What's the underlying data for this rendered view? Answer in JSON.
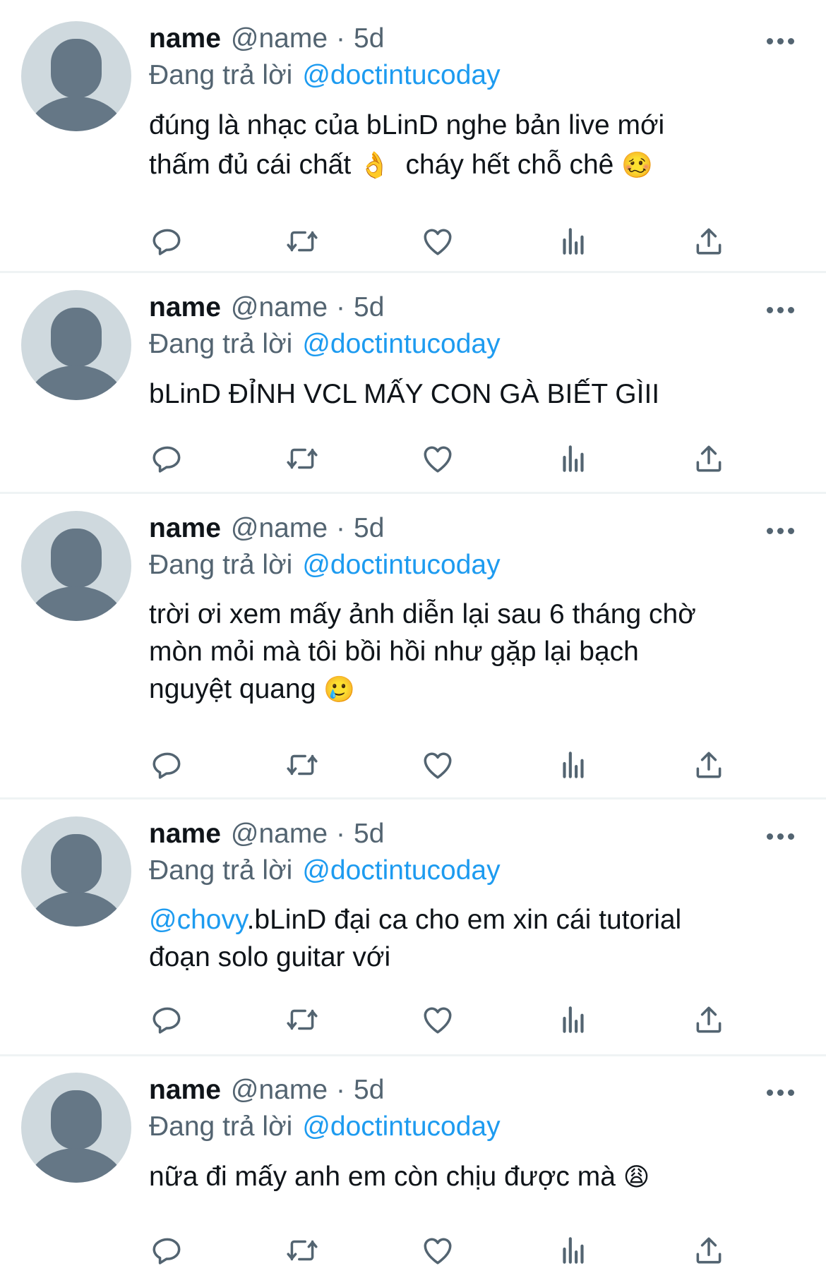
{
  "tweets": [
    {
      "name": "name",
      "handle": "@name",
      "sep": "·",
      "time": "5d",
      "reply_prefix": "Đang trả lời",
      "reply_to": "@doctintucoday",
      "text": "đúng là nhạc của bLinD nghe bản live mới\nthấm đủ cái chất ",
      "emoji_1": "👌",
      "text_2": "  cháy hết chỗ chê ",
      "emoji_2": "🥴"
    },
    {
      "name": "name",
      "handle": "@name",
      "sep": "·",
      "time": "5d",
      "reply_prefix": "Đang trả lời",
      "reply_to": "@doctintucoday",
      "text": "bLinD ĐỈNH VCL MẤY CON GÀ BIẾT GÌII"
    },
    {
      "name": "name",
      "handle": "@name",
      "sep": "·",
      "time": "5d",
      "reply_prefix": "Đang trả lời",
      "reply_to": "@doctintucoday",
      "text": "trời ơi xem mấy ảnh diễn lại sau 6 tháng chờ\nmòn mỏi mà tôi bồi hồi như gặp lại bạch\nnguyệt quang ",
      "emoji_1": "🥲"
    },
    {
      "name": "name",
      "handle": "@name",
      "sep": "·",
      "time": "5d",
      "reply_prefix": "Đang trả lời",
      "reply_to": "@doctintucoday",
      "mention": "@chovy",
      "text": ".bLinD đại ca cho em xin cái tutorial\nđoạn solo guitar với"
    },
    {
      "name": "name",
      "handle": "@name",
      "sep": "·",
      "time": "5d",
      "reply_prefix": "Đang trả lời",
      "reply_to": "@doctintucoday",
      "text": "nữa đi mấy anh em còn chịu được mà ",
      "emoji_1": "😩"
    }
  ],
  "icons": {
    "reply": "reply-icon",
    "retweet": "retweet-icon",
    "like": "heart-icon",
    "views": "analytics-icon",
    "share": "share-icon",
    "more": "more-icon"
  },
  "colors": {
    "link": "#1d9bf0",
    "secondary_text": "#536471",
    "icon": "#536471",
    "avatar_bg": "#cfd9de",
    "avatar_fg": "#657786",
    "divider": "#eff3f4"
  }
}
